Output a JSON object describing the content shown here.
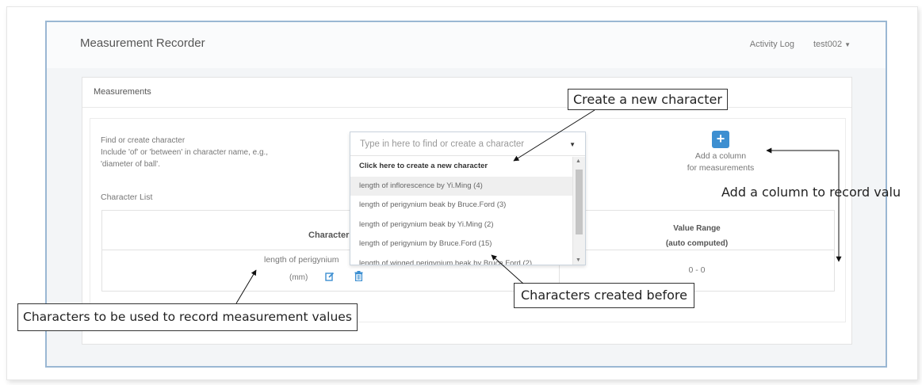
{
  "app": {
    "title": "Measurement Recorder",
    "nav": {
      "activity_log": "Activity Log",
      "user": "test002"
    }
  },
  "panel": {
    "heading": "Measurements",
    "find_label_lines": [
      "Find or create character",
      "Include 'of' or 'between' in character name, e.g.,",
      "'diameter of ball'."
    ],
    "character_list_label": "Character List"
  },
  "search": {
    "placeholder": "Type in here to find or create a character",
    "options": [
      "Click here to create a new character",
      "length of inflorescence by Yi.Ming (4)",
      "length of perigynium beak by Bruce.Ford (3)",
      "length of perigynium beak by Yi.Ming (2)",
      "length of perigynium by Bruce.Ford (15)",
      "length of winged perigynium beak by Bruce.Ford (2)"
    ]
  },
  "add_column": {
    "icon": "+",
    "line1": "Add a column",
    "line2": "for measurements"
  },
  "table": {
    "col_character": "Character",
    "col_range_line1": "Value Range",
    "col_range_line2": "(auto computed)",
    "row": {
      "name": "length of perigynium",
      "unit": "(mm)",
      "range": "0 - 0"
    }
  },
  "annotations": {
    "create_new": "Create a new character",
    "add_column": "Add a column to record valu",
    "created_before": "Characters created before",
    "used_to_record": "Characters to be used to record measurement values"
  },
  "colors": {
    "accent": "#3d8fd1",
    "frame_border": "#9ab7d3"
  },
  "icons": [
    "plus-icon",
    "edit-icon",
    "trash-icon",
    "caret-down-icon"
  ]
}
